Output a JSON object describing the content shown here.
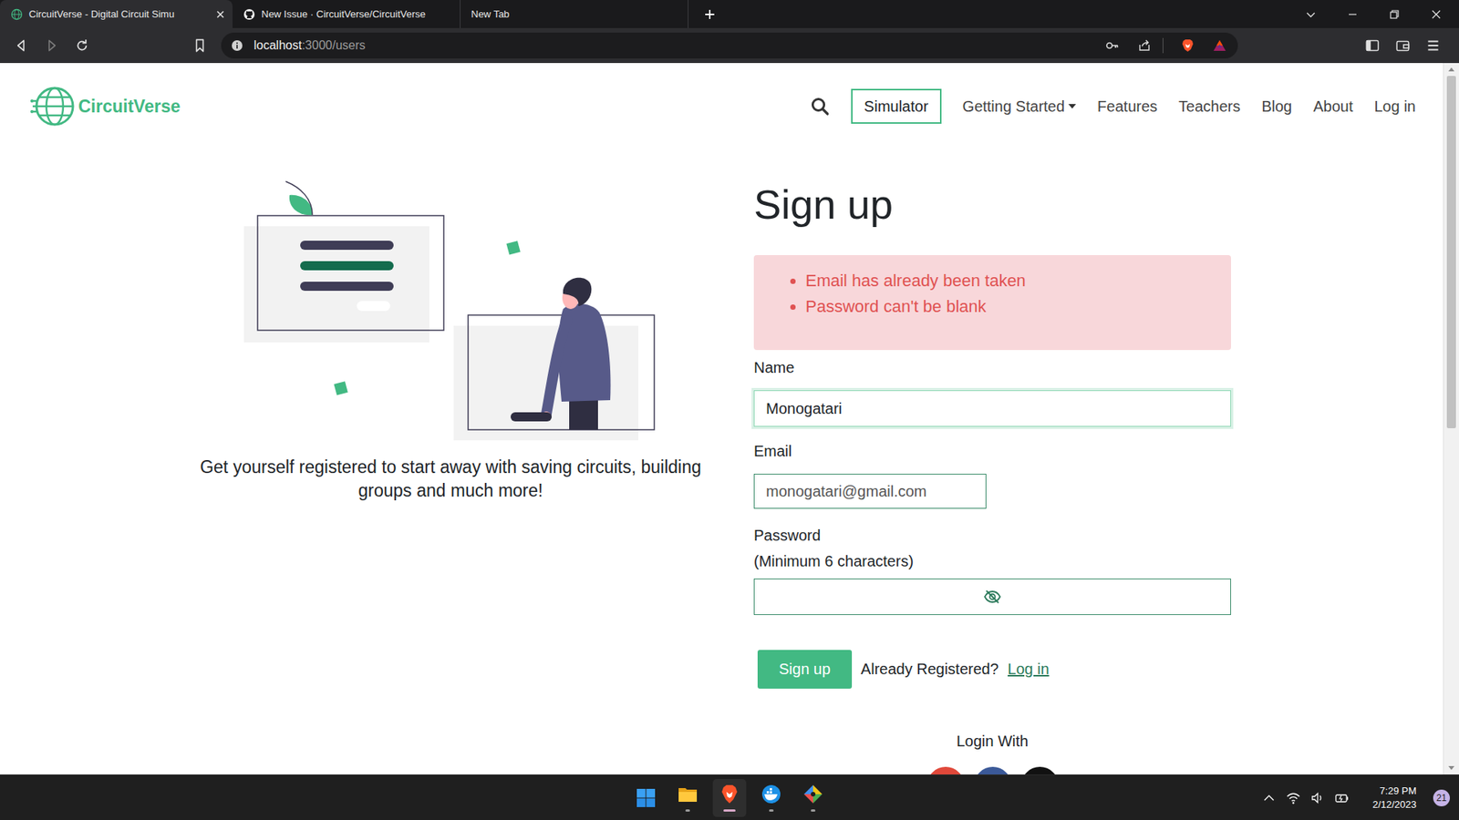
{
  "browser": {
    "tabs": [
      {
        "title": "CircuitVerse - Digital Circuit Simu",
        "selected": true
      },
      {
        "title": "New Issue · CircuitVerse/CircuitVerse",
        "selected": false
      },
      {
        "title": "New Tab",
        "selected": false
      }
    ],
    "address": {
      "host": "localhost",
      "path": ":3000/users"
    }
  },
  "navbar": {
    "logo": "CircuitVerse",
    "simulator": "Simulator",
    "links": [
      {
        "label": "Getting Started",
        "dropdown": true
      },
      {
        "label": "Features",
        "dropdown": false
      },
      {
        "label": "Teachers",
        "dropdown": false
      },
      {
        "label": "Blog",
        "dropdown": false
      },
      {
        "label": "About",
        "dropdown": false
      },
      {
        "label": "Log in",
        "dropdown": false
      }
    ]
  },
  "hero": {
    "tagline": "Get yourself registered to start away with saving circuits, building groups and much more!"
  },
  "signup": {
    "title": "Sign up",
    "errors": [
      "Email has already been taken",
      "Password can't be blank"
    ],
    "fields": [
      {
        "kind": "text",
        "label": "Name",
        "value": "Monogatari",
        "focused": true
      },
      {
        "kind": "email",
        "label": "Email",
        "value": "monogatari@gmail.com",
        "focused": false
      },
      {
        "kind": "password",
        "label": "Password",
        "hint": "(Minimum 6 characters)",
        "value": "",
        "focused": false
      }
    ],
    "submit": "Sign up",
    "login_prompt": "Already Registered?",
    "login_link": "Log in",
    "social": {
      "heading": "Login With",
      "providers": [
        {
          "color": "#e0483a"
        },
        {
          "color": "#3b5998"
        },
        {
          "color": "#111111"
        }
      ]
    }
  },
  "taskbar": {
    "time": "7:29 PM",
    "date": "2/12/2023",
    "notifications": "21"
  }
}
